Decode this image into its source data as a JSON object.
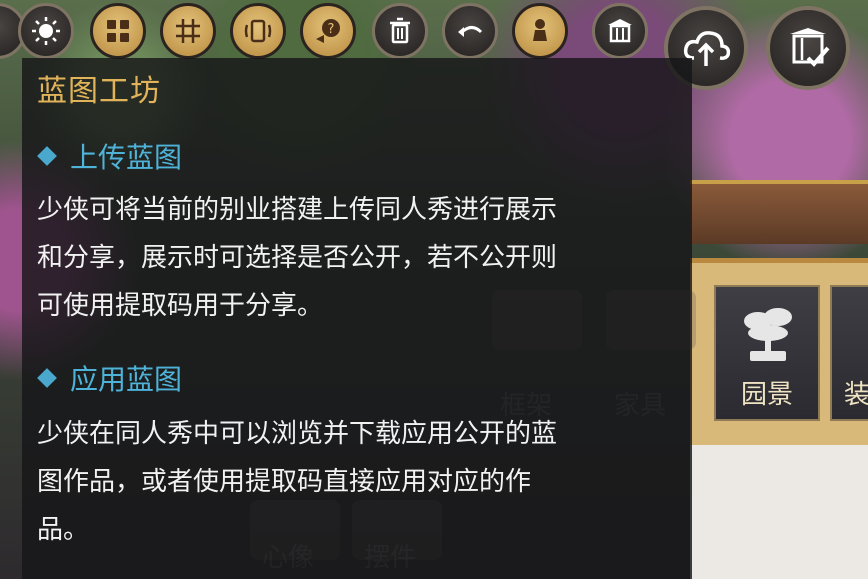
{
  "toolbar": {
    "buttons": [
      {
        "icon": "sun-icon"
      },
      {
        "icon": "layout-grid-icon"
      },
      {
        "icon": "hash-grid-icon"
      },
      {
        "icon": "rotate-icon"
      },
      {
        "icon": "help-icon"
      },
      {
        "icon": "trash-icon"
      },
      {
        "icon": "undo-icon"
      },
      {
        "icon": "character-icon"
      },
      {
        "icon": "building-icon"
      },
      {
        "icon": "cloud-upload-icon"
      },
      {
        "icon": "blueprint-check-icon"
      }
    ]
  },
  "tooltip": {
    "title": "蓝图工坊",
    "sections": [
      {
        "heading": "上传蓝图",
        "lines": [
          "少侠可将当前的别业搭建上传同人秀进行展示",
          "和分享，展示时可选择是否公开，若不公开则",
          "可使用提取码用于分享。"
        ]
      },
      {
        "heading": "应用蓝图",
        "lines": [
          "少侠在同人秀中可以浏览并下载应用公开的蓝",
          "图作品，或者使用提取码直接应用对应的作",
          "品。"
        ]
      }
    ]
  },
  "categories": {
    "faded": [
      "框架",
      "家具",
      "心像",
      "摆件"
    ],
    "visible": [
      "园景",
      "装"
    ]
  },
  "colors": {
    "title": "#e2b45a",
    "section_heading": "#4fb3d9",
    "body_text": "#f2f2f2",
    "gold_button": "#d2ad62"
  }
}
